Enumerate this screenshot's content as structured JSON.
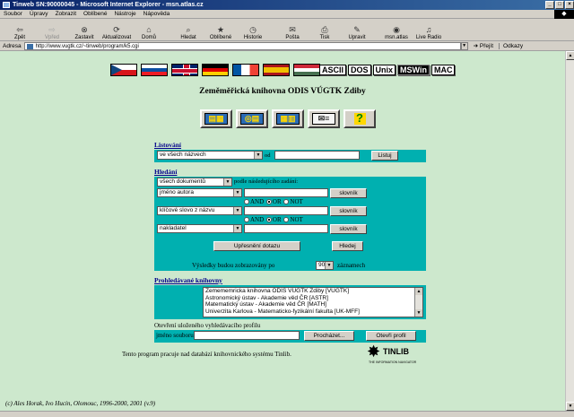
{
  "window": {
    "title": "Tinweb SN:90000045 - Microsoft Internet Explorer - msn.atlas.cz"
  },
  "menu": [
    "Soubor",
    "Úpravy",
    "Zobrazit",
    "Oblíbené",
    "Nástroje",
    "Nápověda"
  ],
  "toolbar": {
    "buttons": [
      {
        "label": "Zpět",
        "icon": "back-arrow-icon",
        "glyph": "⇦"
      },
      {
        "label": "Vpřed",
        "icon": "forward-arrow-icon",
        "glyph": "⇨"
      },
      {
        "label": "Zastavit",
        "icon": "stop-icon",
        "glyph": "⊗"
      },
      {
        "label": "Aktualizovat",
        "icon": "refresh-icon",
        "glyph": "⟳"
      },
      {
        "label": "Domů",
        "icon": "home-icon",
        "glyph": "⌂"
      },
      {
        "label": "Hledat",
        "icon": "search-icon",
        "glyph": "⌕"
      },
      {
        "label": "Oblíbené",
        "icon": "favorites-icon",
        "glyph": "★"
      },
      {
        "label": "Historie",
        "icon": "history-icon",
        "glyph": "◷"
      },
      {
        "label": "Pošta",
        "icon": "mail-icon",
        "glyph": "✉"
      },
      {
        "label": "Tisk",
        "icon": "print-icon",
        "glyph": "⎙"
      },
      {
        "label": "Upravit",
        "icon": "edit-icon",
        "glyph": "✎"
      },
      {
        "label": "msn.atlas",
        "icon": "msn-icon",
        "glyph": "◉"
      },
      {
        "label": "Live Radio",
        "icon": "radio-icon",
        "glyph": "♫"
      }
    ]
  },
  "address": {
    "label": "Adresa",
    "url": "http://www.vugtk.cz/~tinweb/program/k5.cgi",
    "go": "Přejít",
    "links": "Odkazy"
  },
  "page": {
    "code_buttons": [
      "ASCII",
      "DOS",
      "Unix",
      "MSWin",
      "MAC"
    ],
    "title": "Zeměměřická knihovna ODIS VÚGTK Zdiby",
    "listovani": {
      "heading": "Listování",
      "scope": "ve všech názvech",
      "od": "od",
      "button": "Listuj"
    },
    "hledani": {
      "heading": "Hledání",
      "doc_select": "všech dokumentů",
      "doc_suffix": "podle následujícího zadání:",
      "row1_field": "jméno autora",
      "row2_field": "klíčové slovo z názvu",
      "row3_field": "nakladatel",
      "slovnik": "slovník",
      "and": "AND",
      "or": "OR",
      "not": "NOT",
      "refine": "Upřesnění dotazu",
      "search": "Hledej"
    },
    "results": {
      "prefix": "Výsledky budou zobrazovány po",
      "count": "90",
      "suffix": "záznamech"
    },
    "libraries": {
      "heading": "Prohledávané knihovny",
      "items": [
        "Zemememricka knihovna ODIS VUGTK Zdiby [VUGTK]",
        "Astronomický ústav - Akademie věd ČR [ASTR]",
        "Matematický ústav - Akademie věd ČR [MATH]",
        "Univerzita Karlova - Matematicko-fyzikální fakulta [UK-MFF]"
      ]
    },
    "profile": {
      "heading": "Otevření uloženého vyhledávacího profilu",
      "file_label": "jméno souboru:",
      "browse": "Procházet...",
      "open": "Otevři profil"
    },
    "footer_note": "Tento program pracuje nad databází knihovnického systému Tinlib.",
    "tinlib": {
      "name": "TINLIB",
      "tagline": "THE INFORMATION NAVIGATOR"
    },
    "copyright": "(c) Ales Horak, Ivo Hucin, Olomouc, 1996-2000, 2001 (v.9)"
  }
}
